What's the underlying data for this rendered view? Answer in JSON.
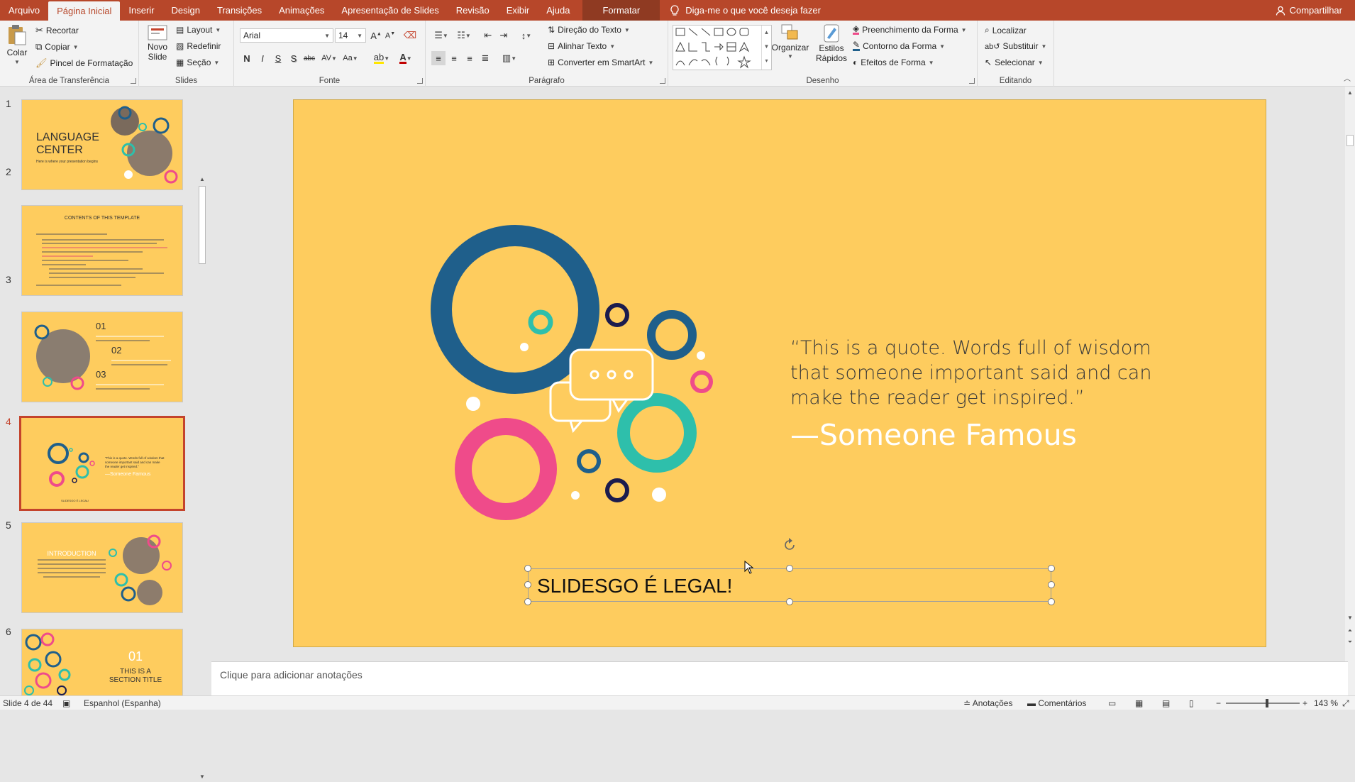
{
  "tabs": {
    "items": [
      "Arquivo",
      "Página Inicial",
      "Inserir",
      "Design",
      "Transições",
      "Animações",
      "Apresentação de Slides",
      "Revisão",
      "Exibir",
      "Ajuda"
    ],
    "context": "Formatar",
    "tellme": "Diga-me o que você deseja fazer",
    "share": "Compartilhar"
  },
  "ribbon": {
    "clipboard": {
      "paste": "Colar",
      "cut": "Recortar",
      "copy": "Copiar",
      "painter": "Pincel de Formatação",
      "label": "Área de Transferência"
    },
    "slides": {
      "new_line1": "Novo",
      "new_line2": "Slide",
      "layout": "Layout",
      "reset": "Redefinir",
      "section": "Seção",
      "label": "Slides"
    },
    "font": {
      "name": "Arial",
      "size": "14",
      "bold": "N",
      "italic": "I",
      "underline": "S",
      "shadow": "S",
      "strike": "abc",
      "spacing": "AV",
      "case": "Aa",
      "color_a": "A",
      "label": "Fonte"
    },
    "paragraph": {
      "direction": "Direção do Texto",
      "align": "Alinhar Texto",
      "smartart": "Converter em SmartArt",
      "label": "Parágrafo"
    },
    "drawing": {
      "arrange": "Organizar",
      "styles_line1": "Estilos",
      "styles_line2": "Rápidos",
      "fill": "Preenchimento da Forma",
      "outline": "Contorno da Forma",
      "effects": "Efeitos de Forma",
      "label": "Desenho"
    },
    "editing": {
      "find": "Localizar",
      "replace": "Substituir",
      "select": "Selecionar",
      "label": "Editando"
    }
  },
  "thumbnails": [
    {
      "num": "1",
      "title": "LANGUAGE CENTER",
      "sub": "Here is where your presentation begins"
    },
    {
      "num": "2",
      "title": "CONTENTS OF THIS TEMPLATE"
    },
    {
      "num": "3",
      "n1": "01",
      "n2": "02",
      "n3": "03"
    },
    {
      "num": "4",
      "quote": "“This is a quote. Words full of wisdom that someone important said and can make the reader get inspired.”",
      "author": "—Someone Famous",
      "footer": "SLIDESGO É LEGAL!"
    },
    {
      "num": "5",
      "title": "INTRODUCTION"
    },
    {
      "num": "6",
      "n": "01",
      "title": "THIS IS A SECTION TITLE"
    }
  ],
  "slide": {
    "quote": "“This is a quote. Words full of wisdom that someone important said and can make the reader get inspired.”",
    "author": "—Someone Famous",
    "textbox": "SLIDESGO É LEGAL!"
  },
  "notes": "Clique para adicionar anotações",
  "status": {
    "slide_count": "Slide 4 de 44",
    "language": "Espanhol (Espanha)",
    "notes": "Anotações",
    "comments": "Comentários",
    "zoom": "143 %"
  },
  "colors": {
    "accent": "#b7472a",
    "slide_bg": "#fecc5e",
    "navy": "#1f5f8b",
    "teal": "#2ebfab",
    "pink": "#ef4b8a",
    "dark": "#1c1c4e"
  }
}
